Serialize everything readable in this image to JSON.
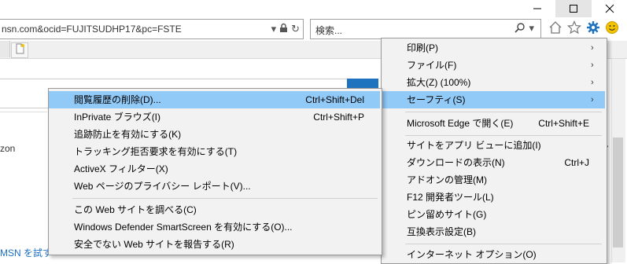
{
  "titlebar": {
    "minimize_icon": "minimize-icon",
    "maximize_icon": "maximize-icon",
    "close_icon": "close-icon"
  },
  "address_bar": {
    "url": "nsn.com&ocid=FUJITSUDHP17&pc=FSTE",
    "lock_icon": "lock-icon",
    "refresh_icon": "refresh-icon"
  },
  "search_box": {
    "placeholder": "検索...",
    "search_icon": "search-icon",
    "dropdown_icon": "chevron-down-icon"
  },
  "toolbar": {
    "home_icon": "home-icon",
    "favorites_icon": "star-icon",
    "tools_icon": "gear-icon",
    "feedback_icon": "smiley-icon"
  },
  "page": {
    "amazon_text": "zon",
    "msn_link": "MSN を試す"
  },
  "tools_menu": {
    "items": [
      {
        "label": "印刷(P)",
        "shortcut": "",
        "has_submenu": true
      },
      {
        "label": "ファイル(F)",
        "shortcut": "",
        "has_submenu": true
      },
      {
        "label": "拡大(Z) (100%)",
        "shortcut": "",
        "has_submenu": true
      },
      {
        "label": "セーフティ(S)",
        "shortcut": "",
        "has_submenu": true
      },
      {
        "label": "Microsoft Edge で開く(E)",
        "shortcut": "Ctrl+Shift+E",
        "has_submenu": false
      },
      {
        "label": "サイトをアプリ ビューに追加(I)",
        "shortcut": "",
        "has_submenu": false
      },
      {
        "label": "ダウンロードの表示(N)",
        "shortcut": "Ctrl+J",
        "has_submenu": false
      },
      {
        "label": "アドオンの管理(M)",
        "shortcut": "",
        "has_submenu": false
      },
      {
        "label": "F12 開発者ツール(L)",
        "shortcut": "",
        "has_submenu": false
      },
      {
        "label": "ピン留めサイト(G)",
        "shortcut": "",
        "has_submenu": false
      },
      {
        "label": "互換表示設定(B)",
        "shortcut": "",
        "has_submenu": false
      },
      {
        "label": "インターネット オプション(O)",
        "shortcut": "",
        "has_submenu": false
      }
    ]
  },
  "safety_submenu": {
    "items": [
      {
        "label": "閲覧履歴の削除(D)...",
        "shortcut": "Ctrl+Shift+Del"
      },
      {
        "label": "InPrivate ブラウズ(I)",
        "shortcut": "Ctrl+Shift+P"
      },
      {
        "label": "追跡防止を有効にする(K)",
        "shortcut": ""
      },
      {
        "label": "トラッキング拒否要求を有効にする(T)",
        "shortcut": ""
      },
      {
        "label": "ActiveX フィルター(X)",
        "shortcut": ""
      },
      {
        "label": "Web ページのプライバシー レポート(V)...",
        "shortcut": ""
      },
      {
        "label": "この Web サイトを調べる(C)",
        "shortcut": ""
      },
      {
        "label": "Windows Defender SmartScreen を有効にする(O)...",
        "shortcut": ""
      },
      {
        "label": "安全でない Web サイトを報告する(R)",
        "shortcut": ""
      }
    ]
  },
  "colors": {
    "highlight": "#91c9f7",
    "menu_bg": "#f2f2f2",
    "gear_blue": "#1e73be",
    "smiley_yellow": "#f5c400",
    "link_blue": "#1a6fc4"
  }
}
